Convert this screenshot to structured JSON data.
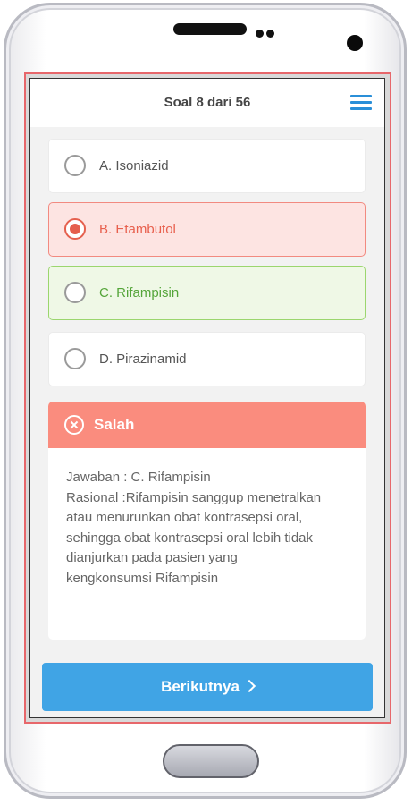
{
  "header": {
    "title": "Soal 8 dari 56"
  },
  "options": [
    {
      "label": "A. Isoniazid",
      "state": "neutral"
    },
    {
      "label": "B. Etambutol",
      "state": "selected-wrong"
    },
    {
      "label": "C. Rifampisin",
      "state": "correct"
    },
    {
      "label": "D. Pirazinamid",
      "state": "neutral"
    }
  ],
  "result": {
    "status": "Salah",
    "lines": [
      "Jawaban : C. Rifampisin",
      "Rasional :Rifampisin sanggup menetralkan",
      "atau menurunkan obat kontrasepsi oral,",
      "sehingga obat kontrasepsi oral lebih tidak",
      "dianjurkan pada pasien yang",
      "kengkonsumsi Rifampisin"
    ]
  },
  "footer": {
    "next_label": "Berikutnya"
  },
  "colors": {
    "accent": "#40a4e5",
    "wrong": "#fa8c7e",
    "correct": "#9bd66e",
    "menu_icon": "#2a8fd8"
  },
  "icons": {
    "menu": "hamburger-menu-icon",
    "status": "x-circle-icon",
    "next": "chevron-right-icon"
  }
}
